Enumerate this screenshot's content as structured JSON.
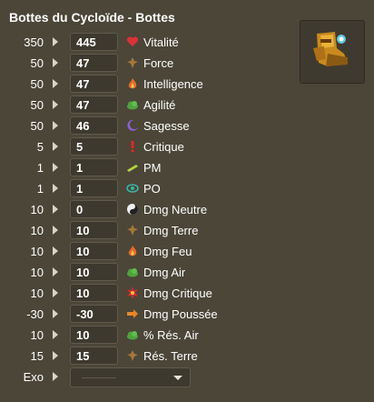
{
  "title": "Bottes du Cycloïde - Bottes",
  "item_image": "boots-icon",
  "stats": [
    {
      "base": "350",
      "value": "445",
      "label": "Vitalité",
      "icon": "heart-icon",
      "color": "#e0303a"
    },
    {
      "base": "50",
      "value": "47",
      "label": "Force",
      "icon": "earth-icon",
      "color": "#a5773a"
    },
    {
      "base": "50",
      "value": "47",
      "label": "Intelligence",
      "icon": "fire-icon",
      "color": "#e8692a"
    },
    {
      "base": "50",
      "value": "47",
      "label": "Agilité",
      "icon": "air-icon",
      "color": "#4fa33f"
    },
    {
      "base": "50",
      "value": "46",
      "label": "Sagesse",
      "icon": "wisdom-icon",
      "color": "#8b5fd6"
    },
    {
      "base": "5",
      "value": "5",
      "label": "Critique",
      "icon": "critical-icon",
      "color": "#e02828"
    },
    {
      "base": "1",
      "value": "1",
      "label": "PM",
      "icon": "movement-icon",
      "color": "#b5d43a"
    },
    {
      "base": "1",
      "value": "1",
      "label": "PO",
      "icon": "range-icon",
      "color": "#3ab3a6"
    },
    {
      "base": "10",
      "value": "0",
      "label": "Dmg Neutre",
      "icon": "neutral-icon",
      "color": "#f0f0f0"
    },
    {
      "base": "10",
      "value": "10",
      "label": "Dmg Terre",
      "icon": "earth-icon",
      "color": "#a5773a"
    },
    {
      "base": "10",
      "value": "10",
      "label": "Dmg Feu",
      "icon": "fire-icon",
      "color": "#e8692a"
    },
    {
      "base": "10",
      "value": "10",
      "label": "Dmg Air",
      "icon": "air-icon",
      "color": "#4fa33f"
    },
    {
      "base": "10",
      "value": "10",
      "label": "Dmg Critique",
      "icon": "critical-damage-icon",
      "color": "#e02828"
    },
    {
      "base": "-30",
      "value": "-30",
      "label": "Dmg Poussée",
      "icon": "pushback-icon",
      "color": "#e8862a"
    },
    {
      "base": "10",
      "value": "10",
      "label": "% Rés. Air",
      "icon": "air-icon",
      "color": "#4fa33f"
    },
    {
      "base": "15",
      "value": "15",
      "label": "Rés. Terre",
      "icon": "earth-icon",
      "color": "#a5773a"
    }
  ],
  "exo": {
    "base": "Exo",
    "selected": ""
  }
}
